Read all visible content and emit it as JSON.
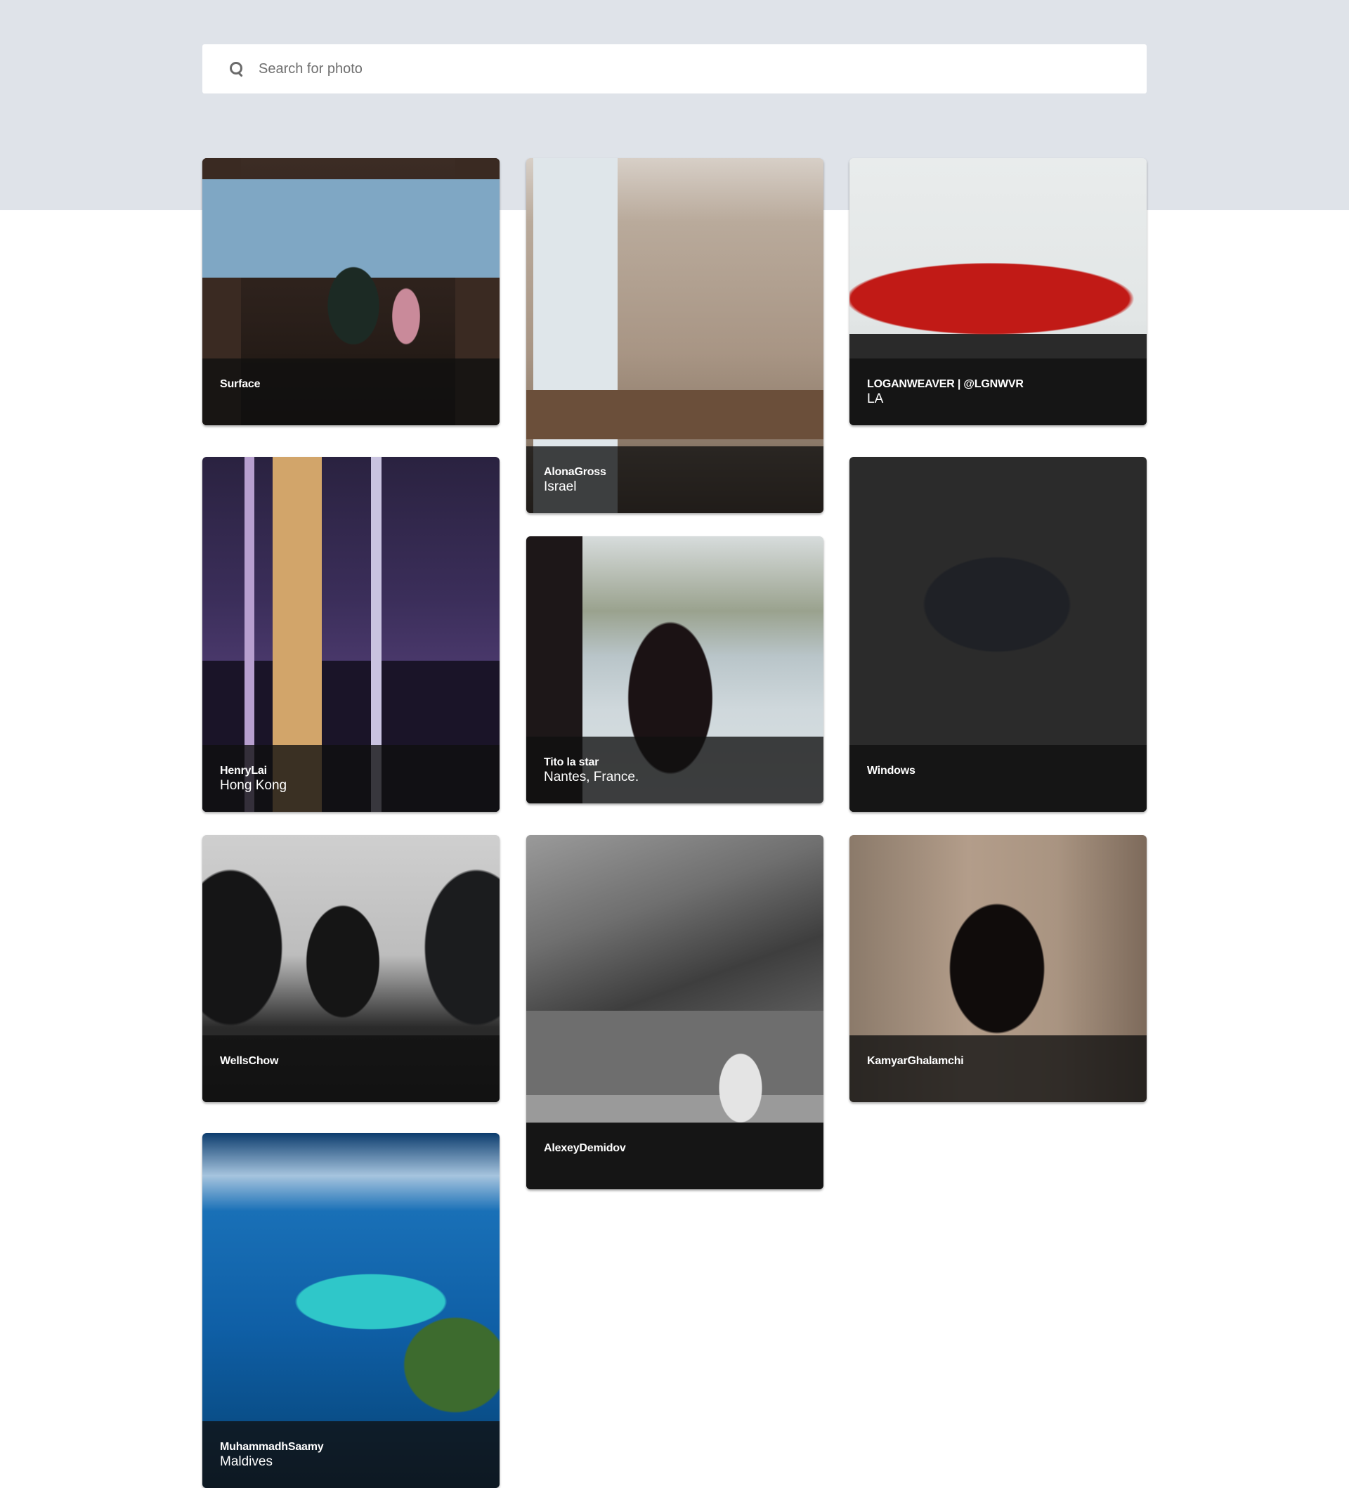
{
  "search": {
    "placeholder": "Search for photo",
    "icon": "search-icon"
  },
  "colors": {
    "hero_band": "#dfe3e9",
    "caption_overlay": "rgba(15,15,15,0.78)"
  },
  "cards": [
    {
      "author": "Surface",
      "location": ""
    },
    {
      "author": "AlonaGross",
      "location": "Israel"
    },
    {
      "author": "LOGANWEAVER | @LGNWVR",
      "location": "LA"
    },
    {
      "author": "HenryLai",
      "location": "Hong Kong"
    },
    {
      "author": "Tito la star",
      "location": "Nantes, France."
    },
    {
      "author": "Windows",
      "location": ""
    },
    {
      "author": "WellsChow",
      "location": ""
    },
    {
      "author": "AlexeyDemidov",
      "location": ""
    },
    {
      "author": "KamyarGhalamchi",
      "location": ""
    },
    {
      "author": "MuhammadhSaamy",
      "location": "Maldives"
    }
  ]
}
